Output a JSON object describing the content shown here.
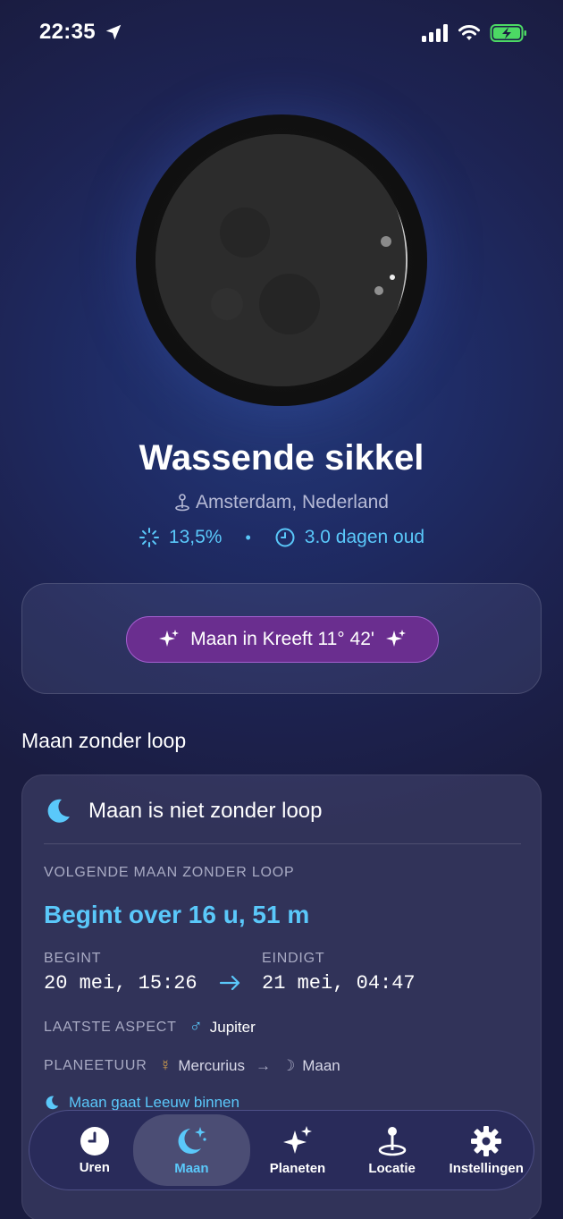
{
  "status": {
    "time": "22:35"
  },
  "moon": {
    "phase_name": "Wassende sikkel",
    "location": "Amsterdam, Nederland",
    "illumination": "13,5%",
    "age": "3.0 dagen oud",
    "sign_label": "Maan in Kreeft 11° 42'"
  },
  "void": {
    "section_title": "Maan zonder loop",
    "status": "Maan is niet zonder loop",
    "next_label": "VOLGENDE MAAN ZONDER LOOP",
    "countdown": "Begint over 16 u, 51 m",
    "begins_label": "BEGINT",
    "begins_value": "20 mei, 15:26",
    "ends_label": "EINDIGT",
    "ends_value": "21 mei, 04:47",
    "last_aspect_label": "LAATSTE ASPECT",
    "last_aspect_symbol": "♂",
    "last_aspect_value": "Jupiter",
    "planet_hour_label": "PLANEETUUR",
    "planet_hour_from_symbol": "☿",
    "planet_hour_from": "Mercurius",
    "planet_hour_arrow": "→",
    "planet_hour_to_symbol": "☽",
    "planet_hour_to": "Maan",
    "enters_text": "Maan gaat Leeuw binnen"
  },
  "tabs": [
    {
      "label": "Uren",
      "icon": "clock-icon"
    },
    {
      "label": "Maan",
      "icon": "moon-stars-icon",
      "active": true
    },
    {
      "label": "Planeten",
      "icon": "sparkles-icon"
    },
    {
      "label": "Locatie",
      "icon": "location-pin-icon"
    },
    {
      "label": "Instellingen",
      "icon": "gear-icon"
    }
  ],
  "colors": {
    "accent": "#5AC8FA",
    "sign_pill": "#6A2E8F",
    "background": "#1D2352"
  }
}
